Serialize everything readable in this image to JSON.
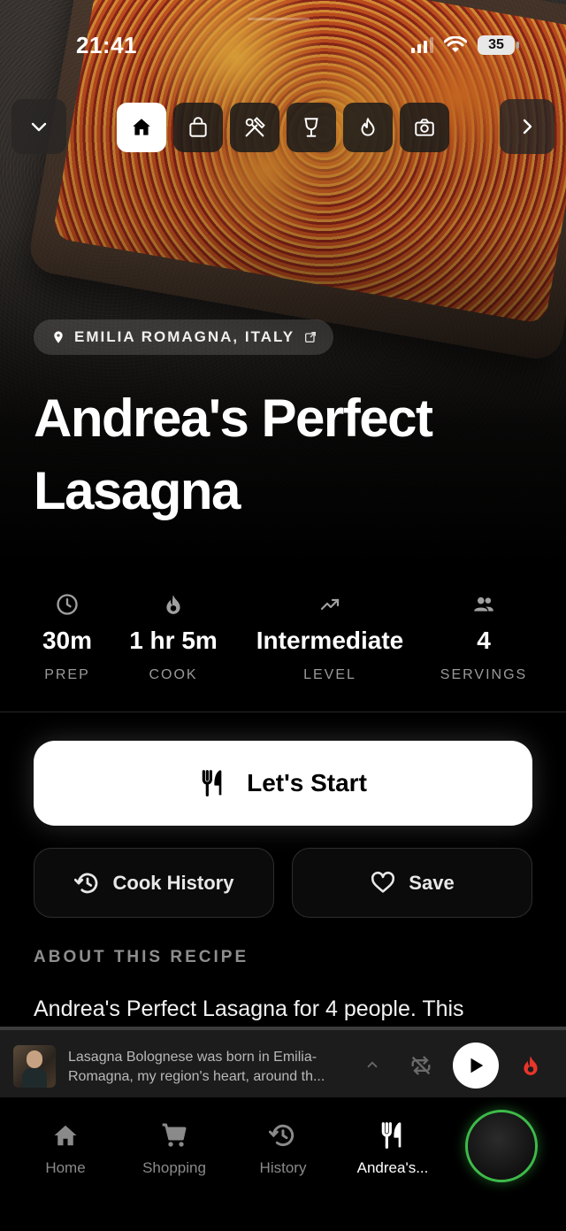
{
  "status_bar": {
    "time": "21:41",
    "battery": "35"
  },
  "toolbar": {
    "tabs": [
      {
        "name": "home",
        "icon": "home-icon",
        "active": true
      },
      {
        "name": "shopping",
        "icon": "shopping-bag-icon",
        "active": false
      },
      {
        "name": "tools",
        "icon": "tools-icon",
        "active": false
      },
      {
        "name": "drinks",
        "icon": "wine-glass-icon",
        "active": false
      },
      {
        "name": "heat",
        "icon": "flame-icon",
        "active": false
      },
      {
        "name": "photos",
        "icon": "camera-icon",
        "active": false
      }
    ]
  },
  "recipe": {
    "location": "EMILIA ROMAGNA, ITALY",
    "title": "Andrea's Perfect Lasagna",
    "stats": [
      {
        "icon": "clock-icon",
        "value": "30m",
        "label": "PREP"
      },
      {
        "icon": "flame-icon",
        "value": "1 hr 5m",
        "label": "COOK"
      },
      {
        "icon": "trending-up-icon",
        "value": "Intermediate",
        "label": "LEVEL"
      },
      {
        "icon": "people-icon",
        "value": "4",
        "label": "SERVINGS"
      }
    ],
    "start_label": "Let's Start",
    "history_label": "Cook History",
    "save_label": "Save",
    "about_heading": "ABOUT THIS RECIPE",
    "about_text": "Andrea's Perfect Lasagna for 4 people. This"
  },
  "player": {
    "line1": "Lasagna Bolognese was born in Emilia-",
    "line2": "Romagna, my region's heart, around th..."
  },
  "nav": {
    "items": [
      {
        "label": "Home",
        "icon": "home-icon"
      },
      {
        "label": "Shopping",
        "icon": "cart-icon"
      },
      {
        "label": "History",
        "icon": "history-icon"
      },
      {
        "label": "Andrea's...",
        "icon": "utensils-icon"
      }
    ]
  },
  "colors": {
    "accent_green": "#3dbb4a",
    "flame_red": "#e8352b"
  }
}
